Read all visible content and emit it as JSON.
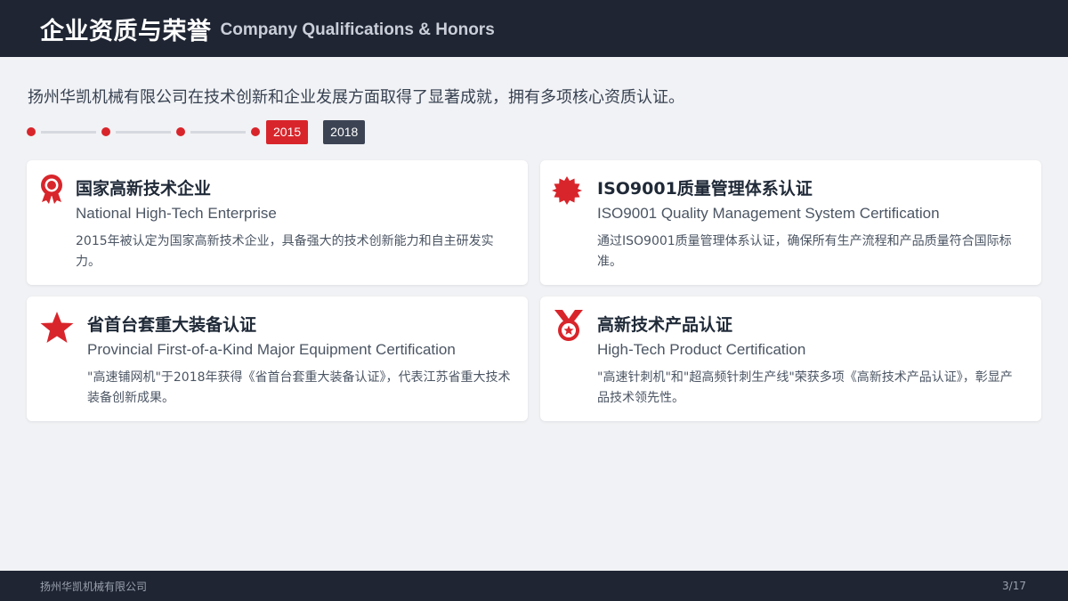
{
  "header": {
    "title_zh": "企业资质与荣誉",
    "title_en": "Company Qualifications & Honors"
  },
  "intro": "扬州华凯机械有限公司在技术创新和企业发展方面取得了显著成就，拥有多项核心资质认证。",
  "timeline": {
    "active_year": "2015",
    "other_year": "2018",
    "accent_color": "#d8252b"
  },
  "cards": [
    {
      "icon": "award-ribbon-icon",
      "title": "国家高新技术企业",
      "subtitle": "National High-Tech Enterprise",
      "description": "2015年被认定为国家高新技术企业，具备强大的技术创新能力和自主研发实力。"
    },
    {
      "icon": "certificate-seal-icon",
      "title": "ISO9001质量管理体系认证",
      "subtitle": "ISO9001 Quality Management System Certification",
      "description": "通过ISO9001质量管理体系认证，确保所有生产流程和产品质量符合国际标准。"
    },
    {
      "icon": "star-icon",
      "title": "省首台套重大装备认证",
      "subtitle": "Provincial First-of-a-Kind Major Equipment Certification",
      "description": "\"高速铺网机\"于2018年获得《省首台套重大装备认证》，代表江苏省重大技术装备创新成果。"
    },
    {
      "icon": "medal-icon",
      "title": "高新技术产品认证",
      "subtitle": "High-Tech Product Certification",
      "description": "\"高速针刺机\"和\"超高频针刺生产线\"荣获多项《高新技术产品认证》，彰显产品技术领先性。"
    }
  ],
  "footer": {
    "company": "扬州华凯机械有限公司",
    "page": "3/17"
  }
}
